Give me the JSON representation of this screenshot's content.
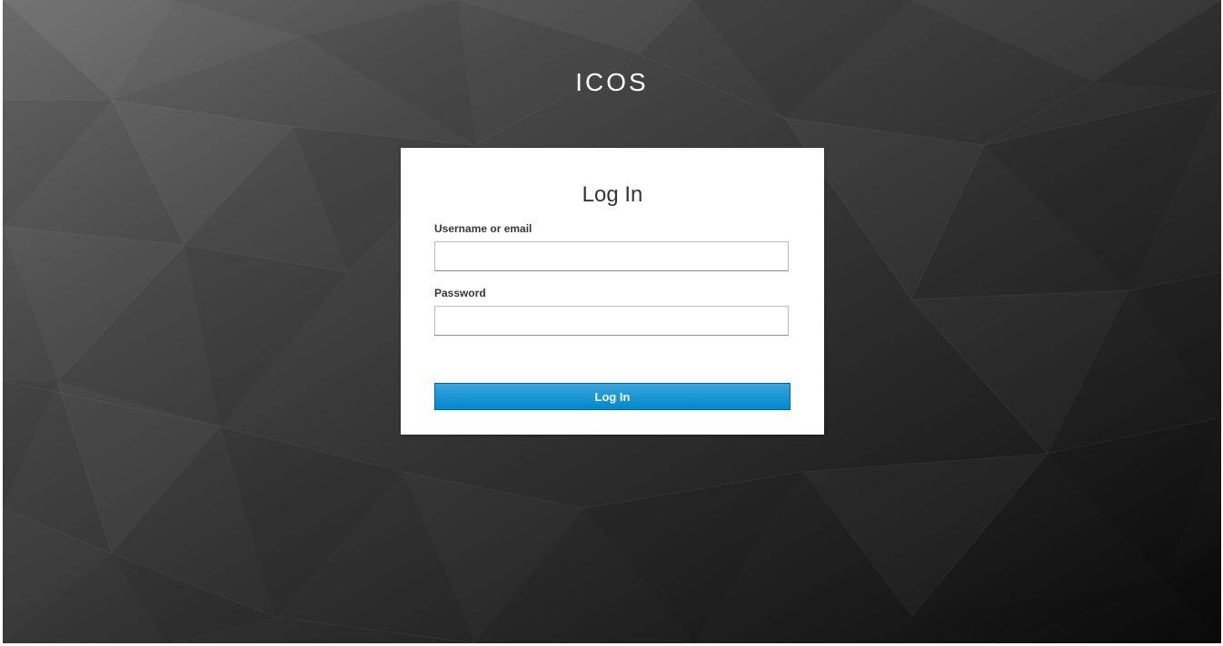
{
  "brand": {
    "title": "ICOS"
  },
  "login_form": {
    "heading": "Log In",
    "username_label": "Username or email",
    "username_value": "",
    "username_placeholder": "",
    "password_label": "Password",
    "password_value": "",
    "password_placeholder": "",
    "submit_label": "Log In"
  },
  "colors": {
    "background_light": "#6b6b6b",
    "background_dark": "#0a0a0a",
    "card_background": "#ffffff",
    "primary_button": "#0088ce",
    "primary_button_border": "#00659c",
    "text": "#363636"
  }
}
